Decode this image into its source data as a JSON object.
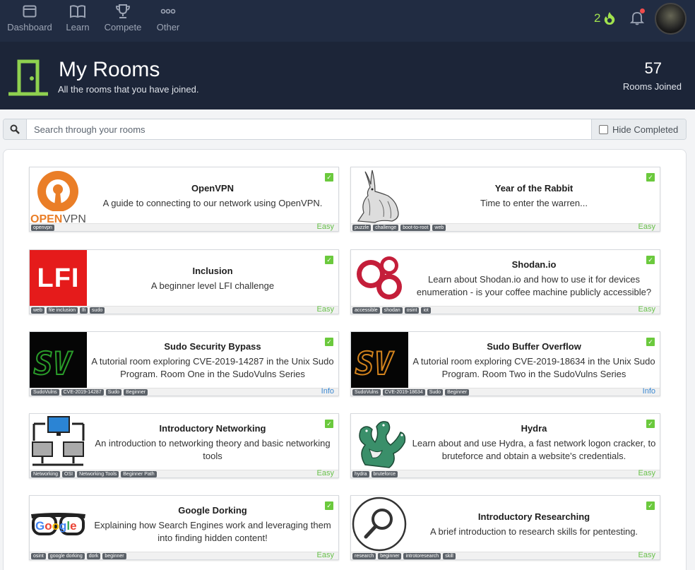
{
  "nav": {
    "items": [
      {
        "label": "Dashboard",
        "icon": "dashboard-icon"
      },
      {
        "label": "Learn",
        "icon": "book-icon"
      },
      {
        "label": "Compete",
        "icon": "trophy-icon"
      },
      {
        "label": "Other",
        "icon": "more-icon"
      }
    ],
    "streak": "2"
  },
  "header": {
    "title": "My Rooms",
    "subtitle": "All the rooms that you have joined.",
    "stat_value": "57",
    "stat_label": "Rooms Joined"
  },
  "search": {
    "placeholder": "Search through your rooms",
    "hide_completed_label": "Hide Completed"
  },
  "colors": {
    "nav_bg": "#212c42",
    "header_bg": "#1c2538",
    "accent_green": "#a1e24e",
    "easy": "#68c04b",
    "info": "#3a87d0"
  },
  "rooms": [
    {
      "title": "OpenVPN",
      "desc": "A guide to connecting to our network using OpenVPN.",
      "tags": [
        "openvpn"
      ],
      "difficulty": "Easy",
      "thumb": "openvpn-logo"
    },
    {
      "title": "Year of the Rabbit",
      "desc": "Time to enter the warren...",
      "tags": [
        "puzzle",
        "challenge",
        "boot-to-root",
        "web"
      ],
      "difficulty": "Easy",
      "thumb": "rabbit-image"
    },
    {
      "title": "Inclusion",
      "desc": "A beginner level LFI challenge",
      "tags": [
        "web",
        "file inclusion",
        "lfi",
        "sudo"
      ],
      "difficulty": "Easy",
      "thumb": "lfi-logo",
      "thumb_text": "LFI"
    },
    {
      "title": "Shodan.io",
      "desc": "Learn about Shodan.io and how to use it for devices enumeration - is your coffee machine publicly accessible?",
      "tags": [
        "accessible",
        "shodan",
        "osint",
        "iot"
      ],
      "difficulty": "Easy",
      "thumb": "shodan-logo"
    },
    {
      "title": "Sudo Security Bypass",
      "desc": "A tutorial room exploring CVE-2019-14287 in the Unix Sudo Program. Room One in the SudoVulns Series",
      "tags": [
        "SudoVulns",
        "CVE-2019-14287",
        "Sudo",
        "Beginner"
      ],
      "difficulty": "Info",
      "thumb": "sv-green-logo"
    },
    {
      "title": "Sudo Buffer Overflow",
      "desc": "A tutorial room exploring CVE-2019-18634 in the Unix Sudo Program. Room Two in the SudoVulns Series",
      "tags": [
        "SudoVulns",
        "CVE-2019-18634",
        "Sudo",
        "Beginner"
      ],
      "difficulty": "Info",
      "thumb": "sv-orange-logo"
    },
    {
      "title": "Introductory Networking",
      "desc": "An introduction to networking theory and basic networking tools",
      "tags": [
        "Networking",
        "OSI",
        "Networking Tools",
        "Beginner Path"
      ],
      "difficulty": "Easy",
      "thumb": "network-icon"
    },
    {
      "title": "Hydra",
      "desc": "Learn about and use Hydra, a fast network logon cracker, to bruteforce and obtain a website's credentials.",
      "tags": [
        "hydra",
        "bruteforce"
      ],
      "difficulty": "Easy",
      "thumb": "hydra-image"
    },
    {
      "title": "Google Dorking",
      "desc": "Explaining how Search Engines work and leveraging them into finding hidden content!",
      "tags": [
        "osint",
        "google dorking",
        "dork",
        "beginner"
      ],
      "difficulty": "Easy",
      "thumb": "google-glasses-logo",
      "thumb_text": "Google"
    },
    {
      "title": "Introductory Researching",
      "desc": "A brief introduction to research skills for pentesting.",
      "tags": [
        "research",
        "beginner",
        "introtoresearch",
        "skill"
      ],
      "difficulty": "Easy",
      "thumb": "magnifier-icon"
    }
  ]
}
